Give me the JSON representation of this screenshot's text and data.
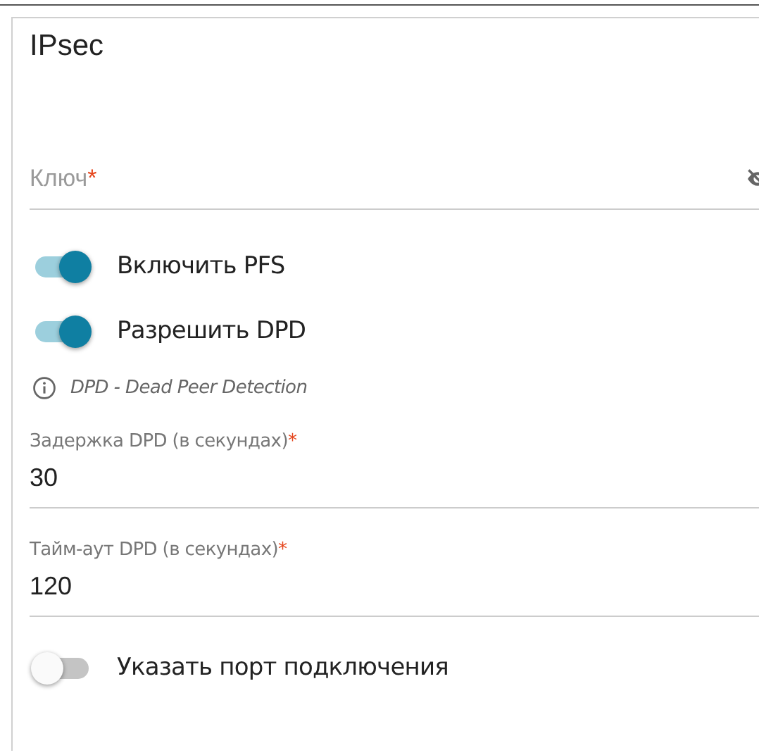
{
  "section": {
    "title": "IPsec"
  },
  "items": [
    {
      "kind": "password",
      "placeholder": "Ключ",
      "required_mark": "*"
    },
    {
      "kind": "switch",
      "label": "Включить PFS",
      "on": true
    },
    {
      "kind": "switch",
      "label": "Разрешить DPD",
      "on": true
    },
    {
      "kind": "hint",
      "text": "DPD - Dead Peer Detection"
    },
    {
      "kind": "text",
      "label": "Задержка DPD (в секундах)",
      "required_mark": "*",
      "value": "30"
    },
    {
      "kind": "text",
      "label": "Тайм-аут DPD (в секундах)",
      "required_mark": "*",
      "value": "120"
    },
    {
      "kind": "switch",
      "label": "Указать порт подключения",
      "on": false
    }
  ]
}
